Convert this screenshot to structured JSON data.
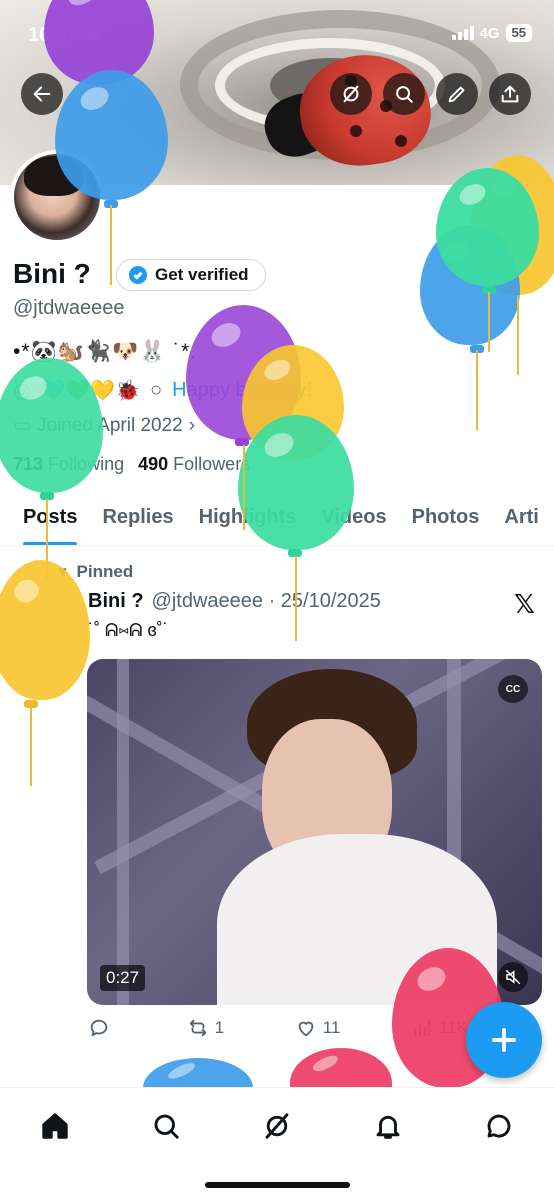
{
  "status_bar": {
    "time": "10:42 ★",
    "network": "4G",
    "battery": "55"
  },
  "profile": {
    "display_name": "Bini ?",
    "verify_label": "Get verified",
    "handle": "@jtdwaeeee",
    "bio_line1": "•*🐼🐿️🐈‍⬛🐶🐰 ˙*.",
    "bio_line2_emoji": "🩵💚💛🐞",
    "bio_birthday": "Happy birthday!",
    "joined": "Joined April 2022",
    "following_count": "713",
    "following_label": "Following",
    "followers_count": "490",
    "followers_label": "Followers"
  },
  "tabs": [
    {
      "label": "Posts",
      "active": true
    },
    {
      "label": "Replies"
    },
    {
      "label": "Highlights"
    },
    {
      "label": "Videos"
    },
    {
      "label": "Photos"
    },
    {
      "label": "Arti"
    }
  ],
  "post": {
    "pinned_label": "Pinned",
    "author": "Bini ?",
    "meta": "@jtdwaeeee · 25/10/2025",
    "text": "˙˚ ᕱ⑅ᕱ ɞ˚˙",
    "video_duration": "0:27",
    "cc_label": "CC",
    "replies": "",
    "reposts": "1",
    "likes": "11",
    "views": "11K"
  },
  "x_logo": "𝕏",
  "icons": {
    "back": "arrow-left-icon",
    "grok": "grok-icon",
    "search": "search-icon",
    "edit": "pencil-icon",
    "share": "share-icon",
    "home": "home-icon",
    "notifications": "bell-icon",
    "messages": "chat-icon"
  },
  "colors": {
    "accent": "#1d9bf0",
    "text": "#0f1419",
    "muted": "#536471"
  }
}
